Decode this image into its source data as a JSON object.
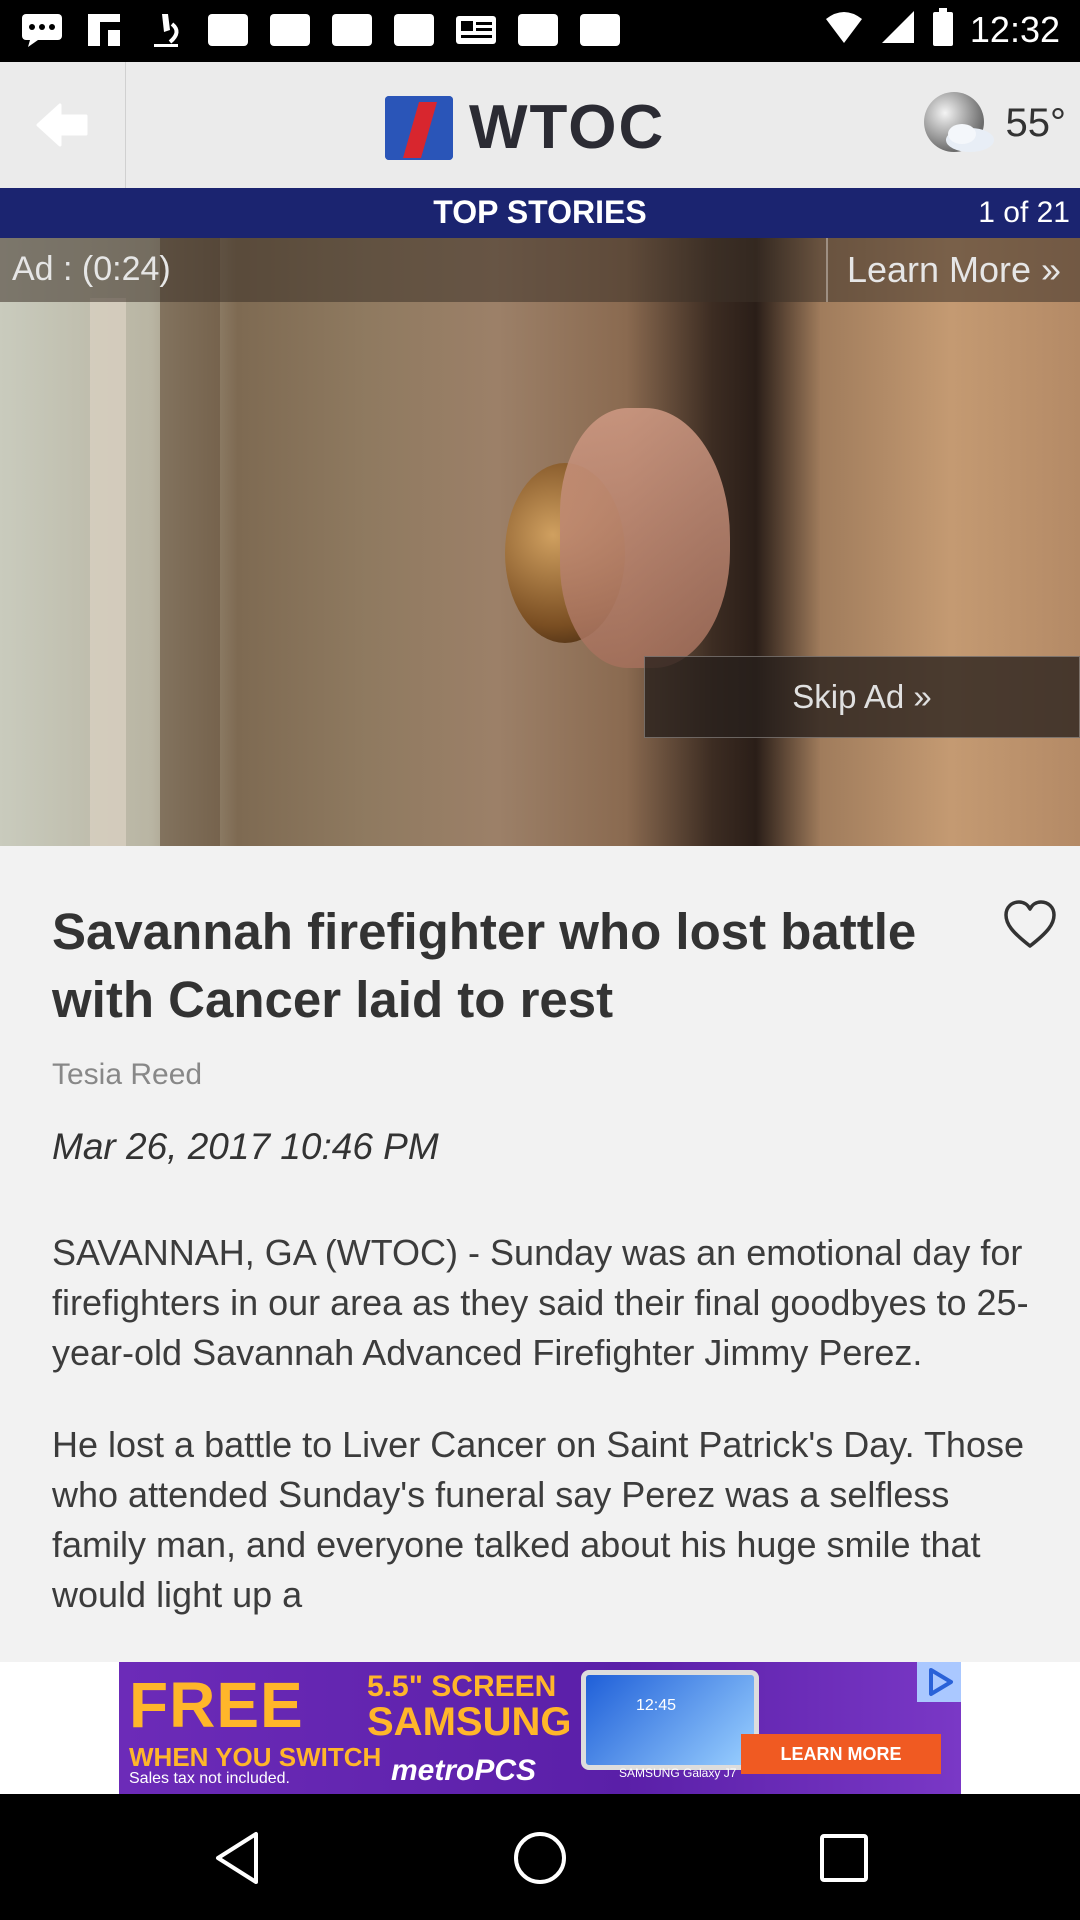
{
  "status_bar": {
    "time": "12:32",
    "icons": [
      "message-icon",
      "flipboard-icon",
      "microscope-icon",
      "notification-icon",
      "notification-icon",
      "notification-icon",
      "notification-icon",
      "news-icon",
      "notification-icon",
      "notification-icon",
      "wifi-icon",
      "signal-icon",
      "battery-icon"
    ]
  },
  "header": {
    "logo_text": "WTOC",
    "weather_temp": "55°",
    "weather_icon": "partly-cloudy-icon"
  },
  "story_bar": {
    "title": "TOP STORIES",
    "position": "1 of 21"
  },
  "video_ad": {
    "timer": "Ad : (0:24)",
    "learn_more": "Learn More »",
    "skip": "Skip Ad »"
  },
  "article": {
    "headline": "Savannah firefighter who lost battle with Cancer laid to rest",
    "author": "Tesia Reed",
    "date": "Mar 26, 2017 10:46 PM",
    "paragraphs": [
      "SAVANNAH, GA (WTOC) - Sunday was an emotional day for firefighters in our area as they said their final goodbyes to 25-year-old Savannah Advanced Firefighter Jimmy Perez.",
      "He lost a battle to Liver Cancer on Saint Patrick's Day. Those who attended Sunday's funeral say Perez was a selfless family man, and everyone talked about his huge smile that would light up a"
    ]
  },
  "banner_ad": {
    "free": "FREE",
    "screen": "5.5\" SCREEN",
    "brand": "SAMSUNG",
    "switch": "WHEN YOU SWITCH",
    "tax": "Sales tax not included.",
    "carrier": "metroPCS",
    "phone_time": "12:45",
    "phone_model": "SAMSUNG Galaxy J7",
    "cta": "LEARN MORE",
    "colors": {
      "background": "#6c2bb8",
      "headline": "#ffb62a",
      "cta": "#f05a22"
    }
  },
  "colors": {
    "story_bar": "#1b2470",
    "logo_blue": "#2a55b8",
    "logo_red": "#d8262e"
  }
}
